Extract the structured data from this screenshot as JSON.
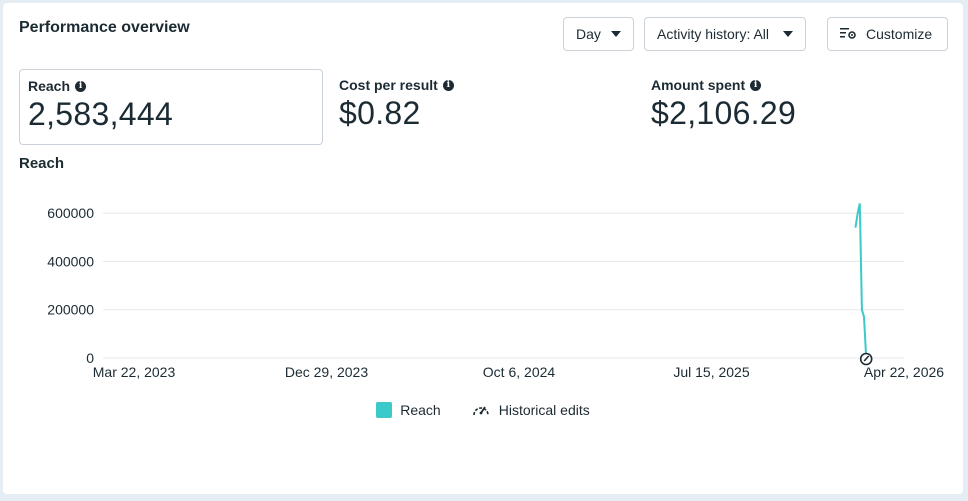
{
  "header": {
    "title": "Performance overview",
    "day_label": "Day",
    "activity_label": "Activity history: All",
    "customize_label": "Customize"
  },
  "metrics": [
    {
      "label": "Reach",
      "value": "2,583,444",
      "selected": true
    },
    {
      "label": "Cost per result",
      "value": "$0.82",
      "selected": false
    },
    {
      "label": "Amount spent",
      "value": "$2,106.29",
      "selected": false
    }
  ],
  "chart_section": {
    "title": "Reach"
  },
  "legend": {
    "reach_label": "Reach",
    "edits_label": "Historical edits"
  },
  "colors": {
    "reach": "#3bc9c9",
    "grid": "#e5e8eb",
    "text": "#1c2b33"
  },
  "icons": {
    "info": "info-icon",
    "caret": "caret-down-icon",
    "customize": "customize-icon",
    "edits": "gauge-icon"
  },
  "chart_data": {
    "type": "line",
    "title": "Reach",
    "xlabel": "",
    "ylabel": "",
    "yticks": [
      0,
      200000,
      400000,
      600000
    ],
    "ylim": [
      0,
      650000
    ],
    "xtick_labels": [
      "Mar 22, 2023",
      "Dec 29, 2023",
      "Oct 6, 2024",
      "Jul 15, 2025",
      "Apr 22, 2026"
    ],
    "xlim": [
      "2023-03-22",
      "2026-04-22"
    ],
    "grid": true,
    "legend_position": "bottom",
    "series": [
      {
        "name": "Reach",
        "color": "#3bc9c9",
        "points": [
          {
            "x": "2026-03-27",
            "y": 540000
          },
          {
            "x": "2026-03-30",
            "y": 600000
          },
          {
            "x": "2026-04-02",
            "y": 640000
          },
          {
            "x": "2026-04-05",
            "y": 200000
          },
          {
            "x": "2026-04-08",
            "y": 170000
          },
          {
            "x": "2026-04-11",
            "y": 0
          }
        ]
      }
    ],
    "events": [
      {
        "x": "2026-04-11",
        "label": "Historical edits"
      }
    ]
  }
}
